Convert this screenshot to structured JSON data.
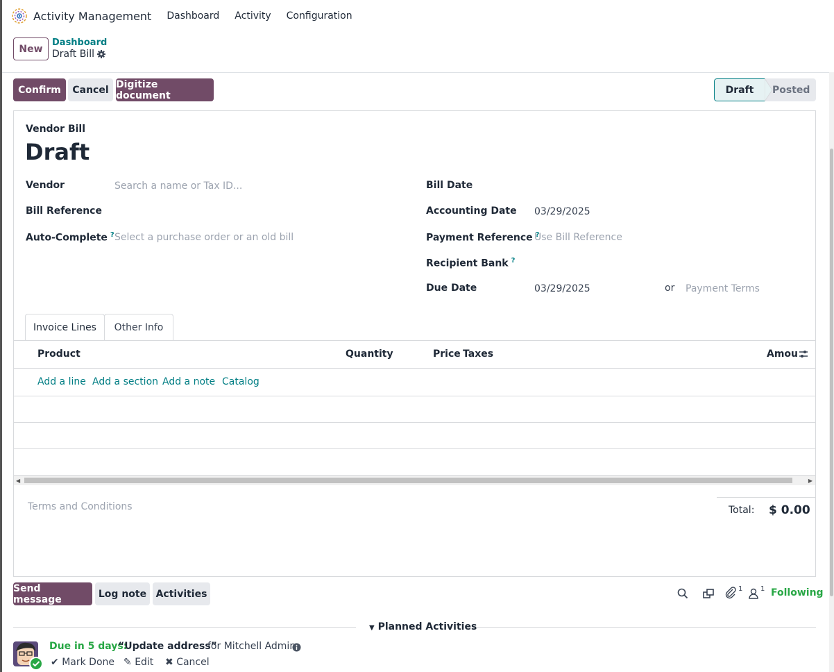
{
  "app": {
    "title": "Activity Management",
    "menu": [
      "Dashboard",
      "Activity",
      "Configuration"
    ]
  },
  "control": {
    "new_label": "New",
    "breadcrumb_parent": "Dashboard",
    "breadcrumb_current": "Draft Bill"
  },
  "actions": {
    "confirm": "Confirm",
    "cancel": "Cancel",
    "digitize": "Digitize document"
  },
  "status": {
    "steps": [
      "Draft",
      "Posted"
    ],
    "current": "Draft"
  },
  "form": {
    "type_label": "Vendor Bill",
    "name": "Draft",
    "vendor_label": "Vendor",
    "vendor_placeholder": "Search a name or Tax ID...",
    "bill_reference_label": "Bill Reference",
    "auto_complete_label": "Auto-Complete",
    "auto_complete_placeholder": "Select a purchase order or an old bill",
    "bill_date_label": "Bill Date",
    "accounting_date_label": "Accounting Date",
    "accounting_date_value": "03/29/2025",
    "payment_reference_label": "Payment Reference",
    "payment_reference_placeholder": "Use Bill Reference",
    "recipient_bank_label": "Recipient Bank",
    "due_date_label": "Due Date",
    "due_date_value": "03/29/2025",
    "or_label": "or",
    "payment_terms_placeholder": "Payment Terms",
    "help_mark": "?"
  },
  "tabs": [
    "Invoice Lines",
    "Other Info"
  ],
  "lines": {
    "columns": [
      "Product",
      "Quantity",
      "Price",
      "Taxes",
      "Amou"
    ],
    "add_links": [
      "Add a line",
      "Add a section",
      "Add a note",
      "Catalog"
    ]
  },
  "footer": {
    "terms_placeholder": "Terms and Conditions",
    "total_label": "Total:",
    "total_value": "$ 0.00"
  },
  "chatter": {
    "send_message": "Send message",
    "log_note": "Log note",
    "activities": "Activities",
    "attachments_count": "1",
    "followers_count": "1",
    "following": "Following",
    "planned_title": "Planned Activities",
    "activity": {
      "due": "Due in 5 days:",
      "summary": "“Update address”",
      "for": "for Mitchell Admin",
      "mark_done": "Mark Done",
      "edit": "Edit",
      "cancel": "Cancel"
    }
  },
  "colors": {
    "primary": "#714b67",
    "link": "#017e84",
    "success": "#28a745"
  }
}
